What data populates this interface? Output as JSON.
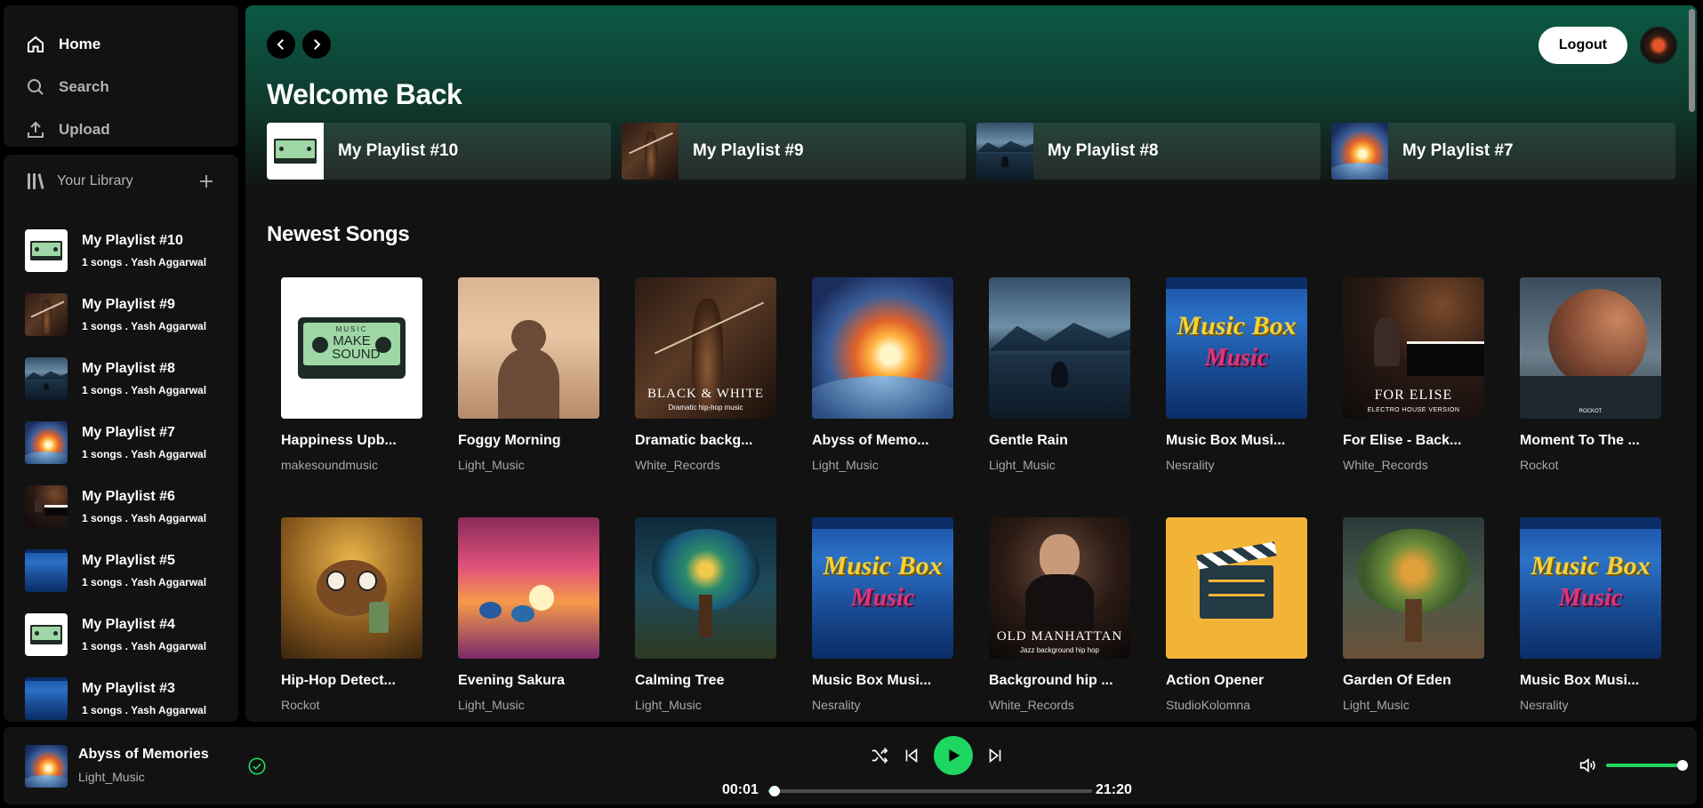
{
  "nav": {
    "home": "Home",
    "search": "Search",
    "upload": "Upload"
  },
  "library": {
    "title": "Your Library",
    "items": [
      {
        "title": "My Playlist #10",
        "meta": "1 songs . Yash Aggarwal",
        "art": "cassette"
      },
      {
        "title": "My Playlist #9",
        "meta": "1 songs . Yash Aggarwal",
        "art": "cello"
      },
      {
        "title": "My Playlist #8",
        "meta": "1 songs . Yash Aggarwal",
        "art": "lake"
      },
      {
        "title": "My Playlist #7",
        "meta": "1 songs . Yash Aggarwal",
        "art": "abyss"
      },
      {
        "title": "My Playlist #6",
        "meta": "1 songs . Yash Aggarwal",
        "art": "piano"
      },
      {
        "title": "My Playlist #5",
        "meta": "1 songs . Yash Aggarwal",
        "art": "musicbox"
      },
      {
        "title": "My Playlist #4",
        "meta": "1 songs . Yash Aggarwal",
        "art": "cassette"
      },
      {
        "title": "My Playlist #3",
        "meta": "1 songs . Yash Aggarwal",
        "art": "musicbox"
      }
    ]
  },
  "header": {
    "logout": "Logout",
    "welcome": "Welcome Back"
  },
  "quick_picks": [
    {
      "label": "My Playlist #10",
      "art": "cassette"
    },
    {
      "label": "My Playlist #9",
      "art": "cello"
    },
    {
      "label": "My Playlist #8",
      "art": "lake"
    },
    {
      "label": "My Playlist #7",
      "art": "abyss"
    }
  ],
  "newest": {
    "title": "Newest Songs",
    "rows": [
      [
        {
          "title": "Happiness Upb...",
          "artist": "makesoundmusic",
          "art": "cassette"
        },
        {
          "title": "Foggy Morning",
          "artist": "Light_Music",
          "art": "foggy"
        },
        {
          "title": "Dramatic backg...",
          "artist": "White_Records",
          "art": "cello"
        },
        {
          "title": "Abyss of Memo...",
          "artist": "Light_Music",
          "art": "abyss"
        },
        {
          "title": "Gentle Rain",
          "artist": "Light_Music",
          "art": "lake"
        },
        {
          "title": "Music Box Musi...",
          "artist": "Nesrality",
          "art": "musicbox"
        },
        {
          "title": "For Elise - Back...",
          "artist": "White_Records",
          "art": "piano"
        },
        {
          "title": "Moment To The ...",
          "artist": "Rockot",
          "art": "moment"
        }
      ],
      [
        {
          "title": "Hip-Hop Detect...",
          "artist": "Rockot",
          "art": "monkey"
        },
        {
          "title": "Evening Sakura",
          "artist": "Light_Music",
          "art": "sakura"
        },
        {
          "title": "Calming Tree",
          "artist": "Light_Music",
          "art": "tree"
        },
        {
          "title": "Music Box Musi...",
          "artist": "Nesrality",
          "art": "musicbox"
        },
        {
          "title": "Background hip ...",
          "artist": "White_Records",
          "art": "manhattan"
        },
        {
          "title": "Action Opener",
          "artist": "StudioKolomna",
          "art": "clapper"
        },
        {
          "title": "Garden Of Eden",
          "artist": "Light_Music",
          "art": "eden"
        },
        {
          "title": "Music Box Musi...",
          "artist": "Nesrality",
          "art": "musicbox"
        }
      ]
    ]
  },
  "art_text": {
    "cassette_top": "MUSIC",
    "cassette_main": "MAKE SOUND",
    "cello_main": "BLACK & WHITE",
    "cello_sub": "Dramatic hip-hop music",
    "musicbox_top": "Music Box",
    "musicbox_bottom": "Music",
    "piano_main": "FOR ELISE",
    "piano_sub": "ELECTRO HOUSE VERSION",
    "manhattan_main": "OLD MANHATTAN",
    "manhattan_sub": "Jazz background hip hop",
    "moment_tag": "ROCKOT"
  },
  "player": {
    "title": "Abyss of Memories",
    "artist": "Light_Music",
    "elapsed": "00:01",
    "duration": "21:20",
    "progress": 0.02,
    "volume": 1.0
  },
  "colors": {
    "accent": "#1ed760",
    "header_green": "#0b5a45",
    "surface": "#121212"
  }
}
